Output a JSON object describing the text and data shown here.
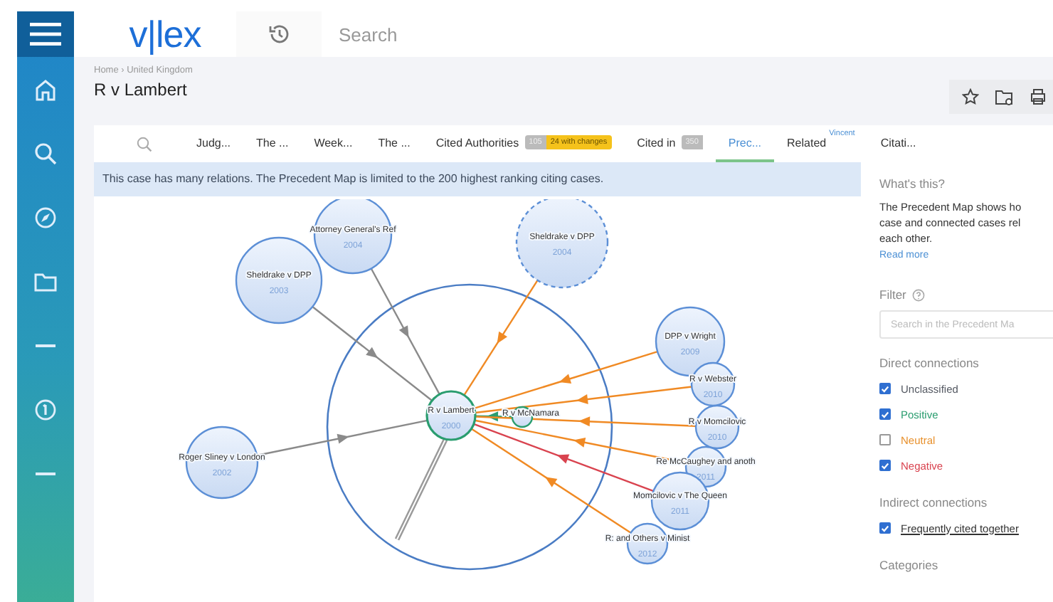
{
  "sidebar": {
    "items": [
      {
        "kind": "menu"
      },
      {
        "kind": "home"
      },
      {
        "kind": "search"
      },
      {
        "kind": "compass"
      },
      {
        "kind": "folder"
      },
      {
        "kind": "divider"
      },
      {
        "kind": "info"
      },
      {
        "kind": "divider"
      }
    ]
  },
  "topbar": {
    "logo": "v|lex",
    "search": {
      "placeholder": "Search"
    }
  },
  "breadcrumb": "Home › United Kingdom",
  "title": "R v Lambert",
  "tabs": [
    {
      "kind": "search"
    },
    {
      "kind": "tab",
      "label": "Judg...",
      "selected": false
    },
    {
      "kind": "tab",
      "label": "The ...",
      "selected": false
    },
    {
      "kind": "tab",
      "label": "Week...",
      "selected": false
    },
    {
      "kind": "tab",
      "label": "The ...",
      "selected": false
    },
    {
      "kind": "tab",
      "label": "Cited Authorities",
      "badge": "105",
      "badge_extra": "24 with changes",
      "selected": false
    },
    {
      "kind": "tab",
      "label": "Cited in",
      "badge": "350",
      "selected": false
    },
    {
      "kind": "tab",
      "label": "Prec...",
      "selected": true
    },
    {
      "kind": "tab",
      "label": "Related",
      "sup": "Vincent",
      "selected": false
    },
    {
      "kind": "tab",
      "label": "Citati...",
      "selected": false
    }
  ],
  "notice": "This case has many relations. The Precedent Map is limited to the 200 highest ranking citing cases.",
  "map": {
    "nodes": [
      {
        "label": "R v Lambert",
        "year": "2000",
        "kind": "focus",
        "dashed": false
      },
      {
        "label": "R v McNamara",
        "kind": "positive",
        "dashed": false
      },
      {
        "label": "Attorney General's Ref",
        "year": "2004",
        "kind": "unclassified",
        "dashed": false
      },
      {
        "label": "Sheldrake v DPP",
        "year": "2003",
        "kind": "unclassified",
        "dashed": false
      },
      {
        "label": "Sheldrake v DPP",
        "year": "2004",
        "kind": "neutral",
        "dashed": true
      },
      {
        "label": "Roger Sliney v London",
        "year": "2002",
        "kind": "unclassified",
        "dashed": false
      },
      {
        "label": "DPP v Wright",
        "year": "2009",
        "kind": "neutral",
        "dashed": false
      },
      {
        "label": "R v Webster",
        "year": "2010",
        "kind": "neutral",
        "dashed": false
      },
      {
        "label": "R v Momcilovic",
        "year": "2010",
        "kind": "neutral",
        "dashed": false
      },
      {
        "label": "Re McCaughey and anoth",
        "year": "2011",
        "kind": "neutral",
        "dashed": false
      },
      {
        "label": "Momcilovic v The Queen",
        "year": "2011",
        "kind": "negative",
        "dashed": false
      },
      {
        "label": "R: and Others v Minist",
        "year": "2012",
        "kind": "neutral",
        "dashed": false
      }
    ]
  },
  "panel": {
    "heading": "What's this?",
    "lines": [
      "The Precedent Map shows ho",
      "case and connected cases rel",
      "each other."
    ],
    "link": "Read more",
    "filter": {
      "label": "Filter",
      "placeholder": "Search in the Precedent Ma"
    },
    "direct": {
      "heading": "Direct connections",
      "items": [
        {
          "label": "Unclassified",
          "checked": true,
          "color": "#555a63"
        },
        {
          "label": "Positive",
          "checked": true,
          "color": "#2a9d6f"
        },
        {
          "label": "Neutral",
          "checked": false,
          "color": "#e8912d"
        },
        {
          "label": "Negative",
          "checked": true,
          "color": "#d9434f"
        }
      ]
    },
    "indirect": {
      "heading": "Indirect connections",
      "items": [
        {
          "label": "Frequently cited together",
          "checked": true
        }
      ]
    },
    "categories": "Categories"
  }
}
